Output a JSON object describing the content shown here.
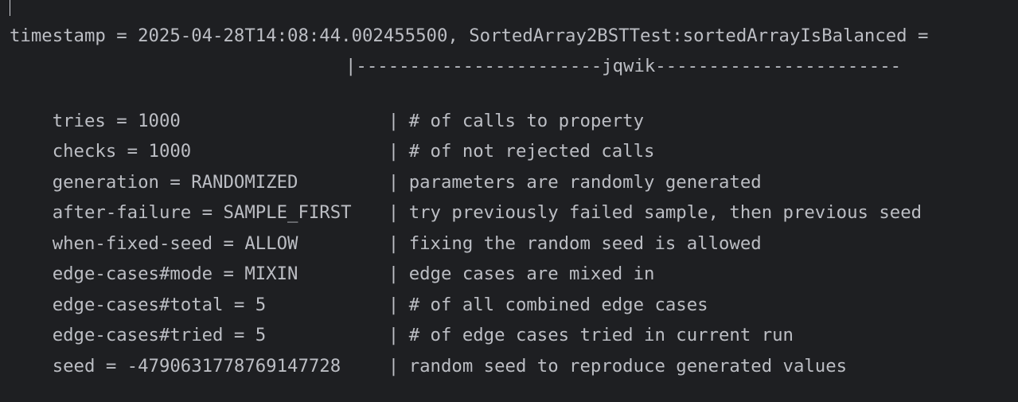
{
  "header": {
    "timestamp_line": "timestamp = 2025-04-28T14:08:44.002455500, SortedArray2BSTTest:sortedArrayIsBalanced =",
    "separator_line": "|-----------------------jqwik-----------------------"
  },
  "rows": [
    {
      "key": "tries = 1000",
      "desc": "# of calls to property"
    },
    {
      "key": "checks = 1000",
      "desc": "# of not rejected calls"
    },
    {
      "key": "generation = RANDOMIZED",
      "desc": "parameters are randomly generated"
    },
    {
      "key": "after-failure = SAMPLE_FIRST",
      "desc": "try previously failed sample, then previous seed"
    },
    {
      "key": "when-fixed-seed = ALLOW",
      "desc": "fixing the random seed is allowed"
    },
    {
      "key": "edge-cases#mode = MIXIN",
      "desc": "edge cases are mixed in"
    },
    {
      "key": "edge-cases#total = 5",
      "desc": "# of all combined edge cases"
    },
    {
      "key": "edge-cases#tried = 5",
      "desc": "# of edge cases tried in current run"
    },
    {
      "key": "seed = -4790631778769147728",
      "desc": "random seed to reproduce generated values"
    }
  ],
  "colors": {
    "background": "#1e1f22",
    "text": "#bcbec4"
  }
}
